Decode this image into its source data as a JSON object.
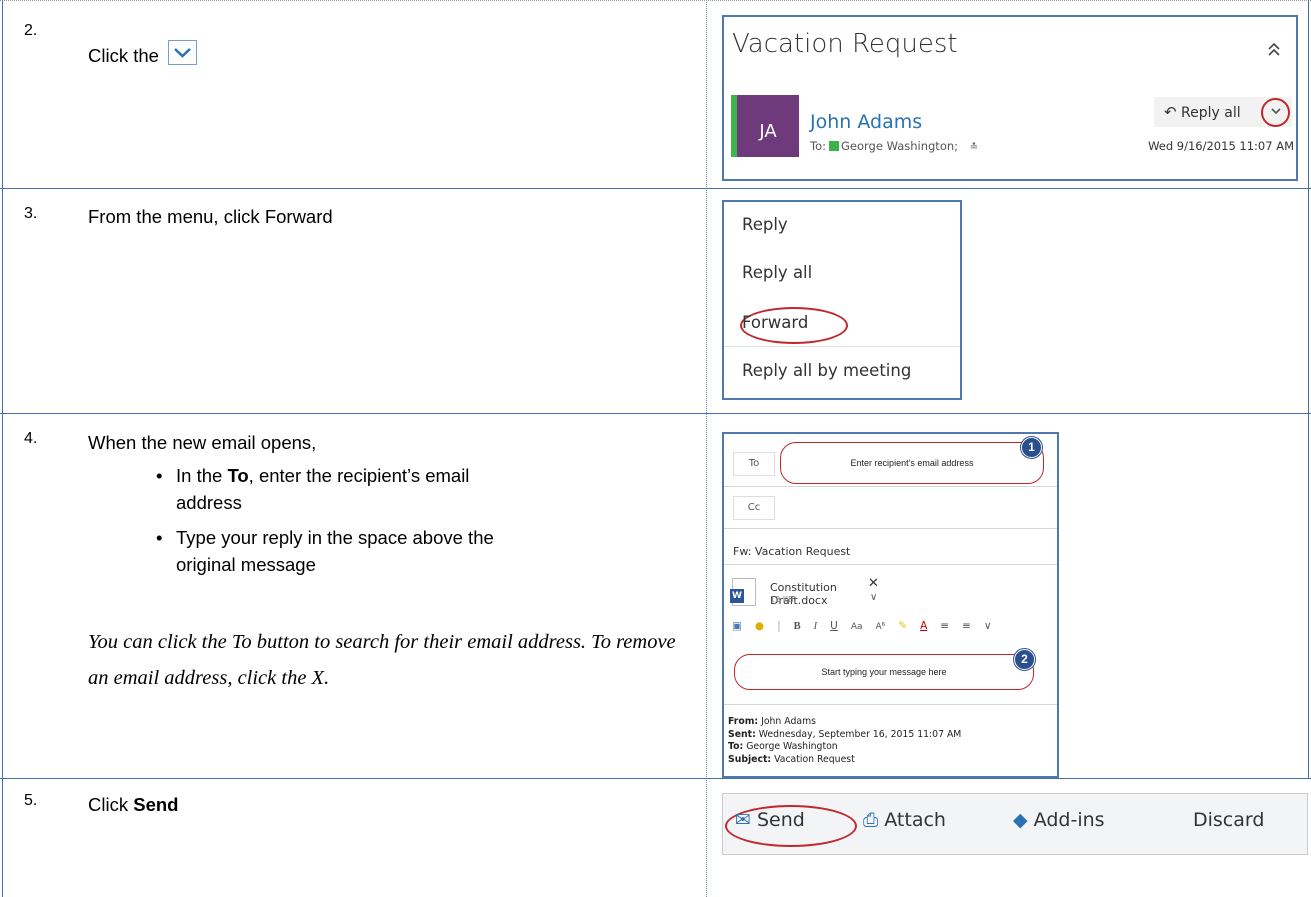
{
  "steps": [
    {
      "num": "2.",
      "text": "Click the"
    },
    {
      "num": "3.",
      "text": "From the menu, click Forward"
    },
    {
      "num": "4.",
      "text": "When the new email opens,",
      "bullets": [
        {
          "pre": "In the ",
          "bold": "To",
          "post": ", enter the recipient’s email",
          "line2": "address"
        },
        {
          "pre": "Type your reply in the space above the",
          "line2": "original message"
        }
      ],
      "note": "You can click the To button to search for their email address. To remove an email address, click the X."
    },
    {
      "num": "5.",
      "text_pre": "Click ",
      "text_bold": "Send"
    }
  ],
  "email_panel": {
    "subject": "Vacation Request",
    "avatar_initials": "JA",
    "sender": "John Adams",
    "to_label": "To:",
    "recipient": "George Washington;",
    "reply_all": "Reply all",
    "date": "Wed 9/16/2015 11:07 AM"
  },
  "menu": [
    "Reply",
    "Reply all",
    "Forward",
    "Reply all by meeting"
  ],
  "compose": {
    "to_btn": "To",
    "to_hint": "Enter recipient’s email address",
    "cc_btn": "Cc",
    "subject": "Fw: Vacation Request",
    "attachment_name": "Constitution Draft.docx",
    "attachment_size": "12 KB",
    "body_hint": "Start typing your message here",
    "badge1": "1",
    "badge2": "2",
    "from_label": "From:",
    "from": "John Adams",
    "sent_label": "Sent:",
    "sent": "Wednesday, September 16, 2015 11:07 AM",
    "to_label": "To:",
    "to": "George Washington",
    "subject_label": "Subject:",
    "subject_val": "Vacation Request"
  },
  "command_bar": {
    "send": "Send",
    "attach": "Attach",
    "addins": "Add-ins",
    "discard": "Discard"
  },
  "colors": {
    "accent_blue": "#4e78b0",
    "highlight_red": "#c0282d",
    "avatar": "#6e3a7c",
    "presence_green": "#37b44a"
  }
}
